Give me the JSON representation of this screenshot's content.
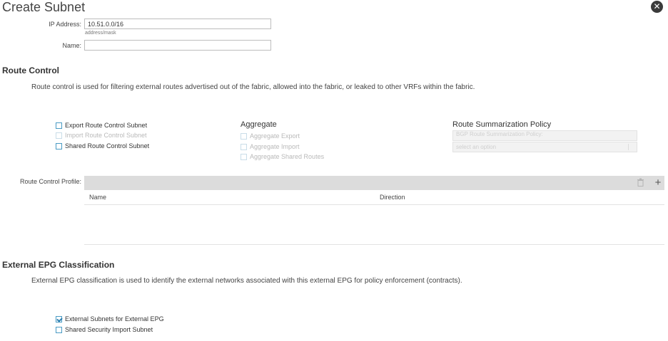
{
  "dialog": {
    "title": "Create Subnet",
    "close_icon": "close-icon"
  },
  "form": {
    "ip_address": {
      "label": "IP Address:",
      "value": "10.51.0.0/16",
      "hint": "address/mask"
    },
    "name": {
      "label": "Name:",
      "value": ""
    }
  },
  "route_control": {
    "heading": "Route Control",
    "description": "Route control is used for filtering external routes advertised out of the fabric, allowed into the fabric, or leaked to other VRFs within the fabric.",
    "subnets": [
      {
        "label": "Export Route Control Subnet",
        "checked": false,
        "disabled": false
      },
      {
        "label": "Import Route Control Subnet",
        "checked": false,
        "disabled": true
      },
      {
        "label": "Shared Route Control Subnet",
        "checked": false,
        "disabled": false
      }
    ],
    "aggregate": {
      "heading": "Aggregate",
      "items": [
        {
          "label": "Aggregate Export",
          "checked": false,
          "disabled": true
        },
        {
          "label": "Aggregate Import",
          "checked": false,
          "disabled": true
        },
        {
          "label": "Aggregate Shared Routes",
          "checked": false,
          "disabled": true
        }
      ]
    },
    "summarization": {
      "heading": "Route Summarization Policy",
      "bgp_label": "BGP Route Summarization Policy:",
      "placeholder": "select an option"
    },
    "profile": {
      "label": "Route Control Profile:",
      "columns": [
        "Name",
        "Direction"
      ],
      "delete_icon": "trash-icon",
      "add_icon": "plus-icon"
    }
  },
  "external_epg": {
    "heading": "External EPG Classification",
    "description": "External EPG classification is used to identify the external networks associated with this external EPG for policy enforcement (contracts).",
    "items": [
      {
        "label": "External Subnets for External EPG",
        "checked": true,
        "disabled": false
      },
      {
        "label": "Shared Security Import Subnet",
        "checked": false,
        "disabled": false
      }
    ]
  }
}
